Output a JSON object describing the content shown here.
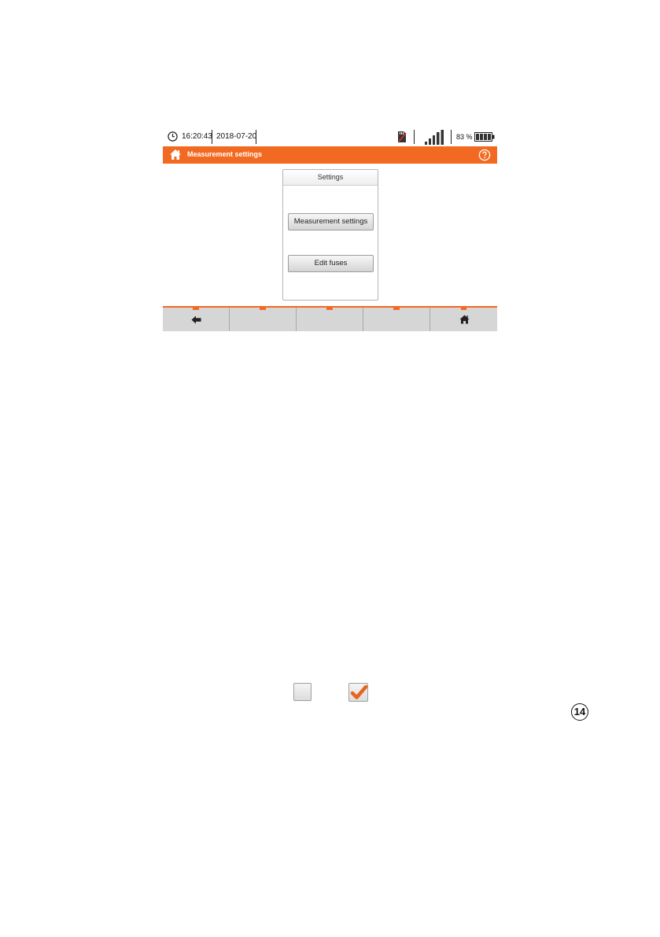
{
  "status_bar": {
    "time": "16:20:43",
    "date": "2018-07-20",
    "battery_percent": "83 %",
    "clock_icon": "clock-icon",
    "sd_icon": "sd-card-icon",
    "signal_icon": "signal-icon",
    "battery_icon": "battery-icon"
  },
  "title_bar": {
    "title": "Measurement settings",
    "home_icon": "home-icon",
    "help_icon": "help-icon"
  },
  "settings_panel": {
    "header": "Settings",
    "buttons": [
      "Measurement settings",
      "Edit fuses"
    ]
  },
  "footer": {
    "keys": [
      "back-arrow-icon",
      "",
      "",
      "",
      "home-icon"
    ]
  },
  "legend": {
    "callout_number": "14"
  },
  "colors": {
    "accent": "#f26a21",
    "footer_bg": "#d6d6d6"
  }
}
